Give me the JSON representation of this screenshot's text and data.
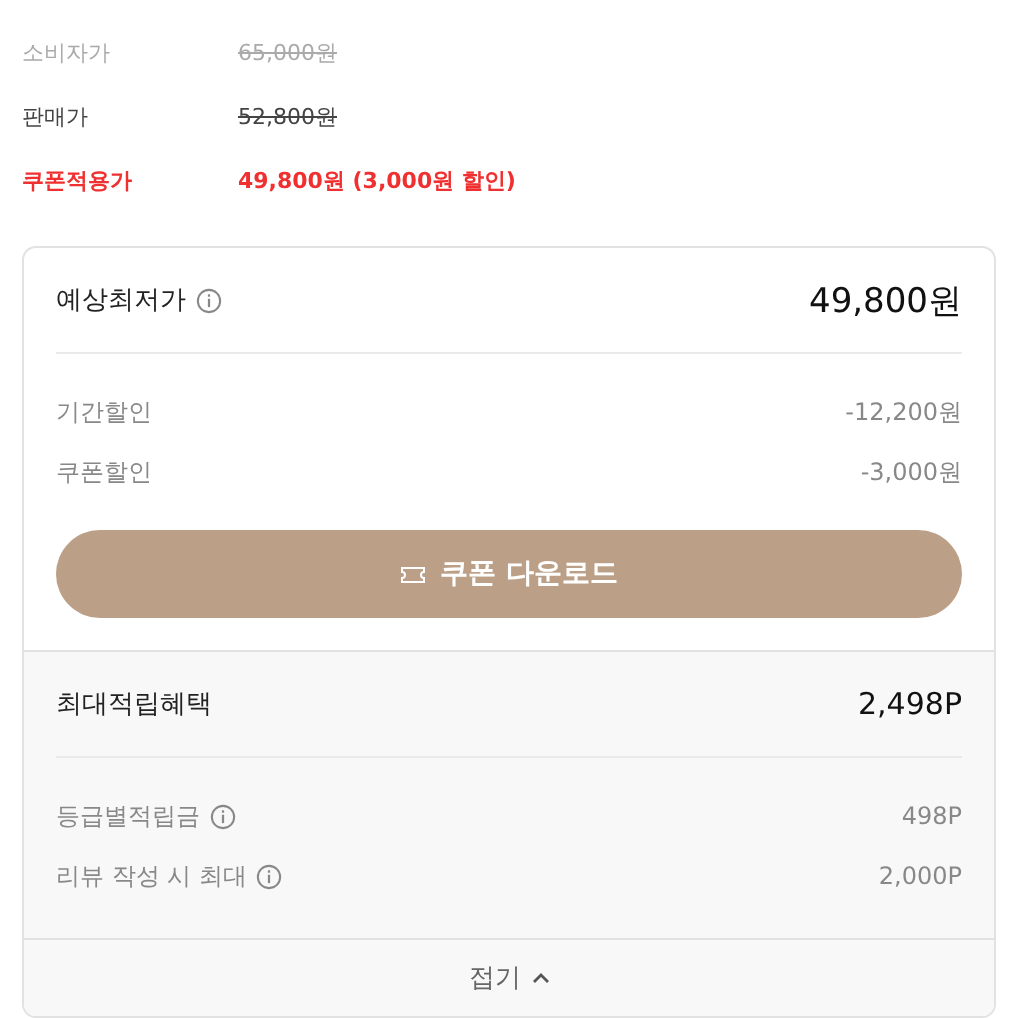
{
  "prices": [
    {
      "kind": "list",
      "label": "소비자가",
      "value": "65,000원"
    },
    {
      "kind": "sale",
      "label": "판매가",
      "value": "52,800원"
    },
    {
      "kind": "coupon",
      "label": "쿠폰적용가",
      "value": "49,800원 (3,000원 할인)"
    }
  ],
  "lowest": {
    "title": "예상최저가",
    "info": true,
    "total": "49,800원",
    "rows": [
      {
        "label": "기간할인",
        "info": false,
        "value": "-12,200원"
      },
      {
        "label": "쿠폰할인",
        "info": false,
        "value": "-3,000원"
      }
    ],
    "button": "쿠폰 다운로드"
  },
  "points": {
    "title": "최대적립혜택",
    "info": false,
    "total": "2,498P",
    "rows": [
      {
        "label": "등급별적립금",
        "info": true,
        "value": "498P"
      },
      {
        "label": "리뷰 작성 시 최대",
        "info": true,
        "value": "2,000P"
      }
    ]
  },
  "footer": {
    "label": "접기",
    "expanded": true
  }
}
